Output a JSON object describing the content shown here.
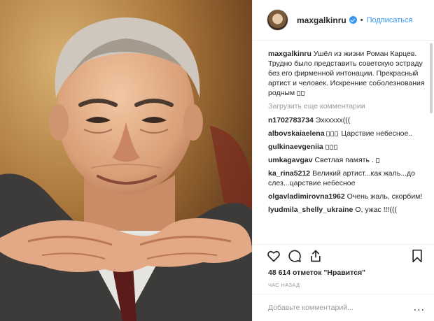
{
  "post": {
    "username": "maxgalkinru",
    "follow_label": "Подписаться",
    "separator": "•",
    "caption_text": "Ушёл из жизни Роман Карцев. Трудно было представить советскую эстраду без его фирменной интонации. Прекрасный артист и человек. Искренние соболезнования родным",
    "load_more": "Загрузить еще комментарии",
    "likes": "48 614 отметок \"Нравится\"",
    "time": "ЧАС НАЗАД",
    "comment_placeholder": "Добавьте комментарий...",
    "more_label": "..."
  },
  "comments": [
    {
      "user": "n1702783734",
      "text": "Эхххххх((("
    },
    {
      "user": "albovskaiaelena",
      "text": "Царствие небесное.."
    },
    {
      "user": "gulkinaevgeniia",
      "text": ""
    },
    {
      "user": "umkagavgav",
      "text": "Светлая память ."
    },
    {
      "user": "ka_rina5212",
      "text": "Великий артист...как жаль...до слез...царствие небесное"
    },
    {
      "user": "olgavladimirovna1962",
      "text": "Очень жаль, скорбим!"
    },
    {
      "user": "lyudmila_shelly_ukraine",
      "text": "О, ужас !!!((("
    }
  ],
  "icons": [
    "heart-icon",
    "comment-icon",
    "share-icon",
    "bookmark-icon",
    "verified-icon"
  ],
  "colors": {
    "link": "#3897f0",
    "text": "#262626",
    "muted": "#999999",
    "border": "#efefef"
  }
}
